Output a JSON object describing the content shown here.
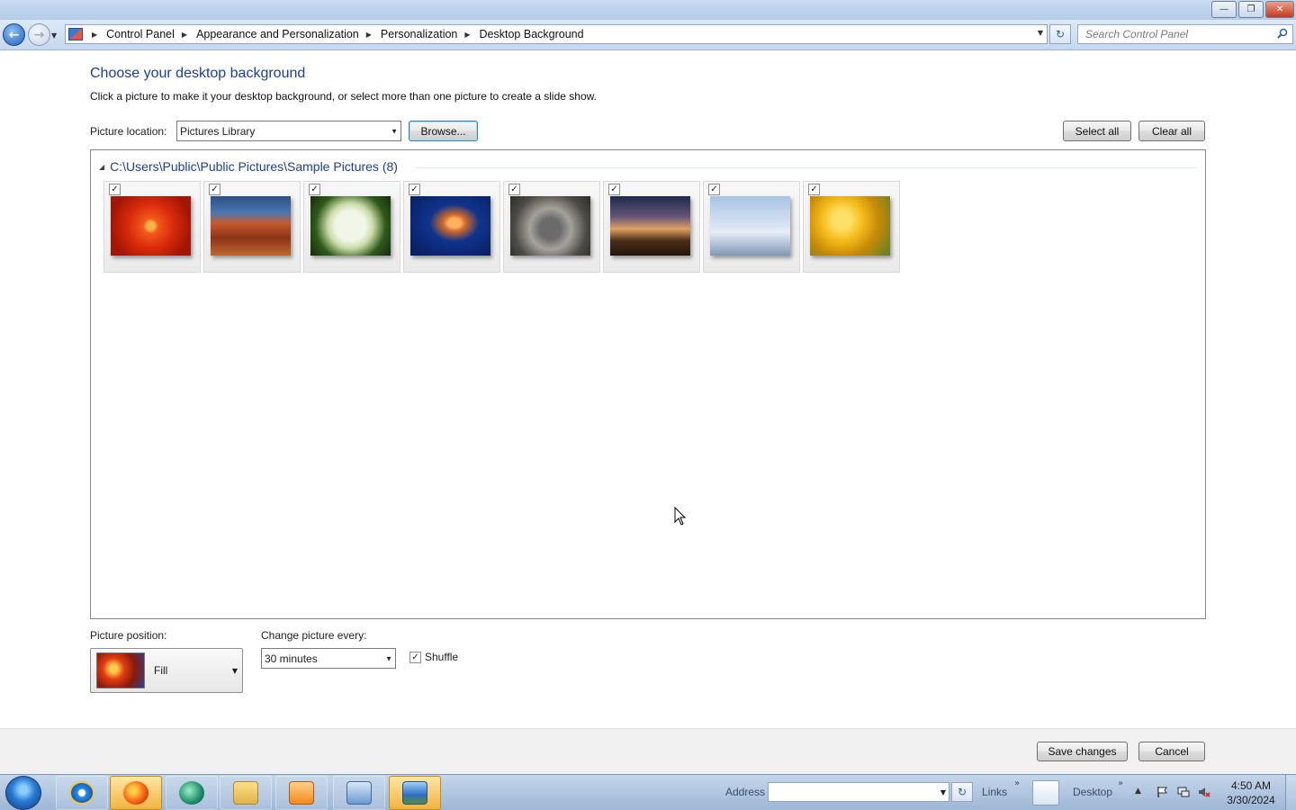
{
  "window": {
    "buttons": [
      "minimize",
      "restore",
      "close"
    ]
  },
  "nav": {
    "breadcrumbs": [
      "Control Panel",
      "Appearance and Personalization",
      "Personalization",
      "Desktop Background"
    ],
    "search_placeholder": "Search Control Panel"
  },
  "content": {
    "heading": "Choose your desktop background",
    "subtext": "Click a picture to make it your desktop background, or select more than one picture to create a slide show.",
    "location_label": "Picture location:",
    "location_value": "Pictures Library",
    "browse_label": "Browse...",
    "select_all_label": "Select all",
    "clear_all_label": "Clear all",
    "group_title": "C:\\Users\\Public\\Public Pictures\\Sample Pictures (8)",
    "pictures": [
      {
        "name": "chrysanthemum",
        "checked": true
      },
      {
        "name": "desert",
        "checked": true
      },
      {
        "name": "hydrangeas",
        "checked": true
      },
      {
        "name": "jellyfish",
        "checked": true
      },
      {
        "name": "koala",
        "checked": true
      },
      {
        "name": "lighthouse",
        "checked": true
      },
      {
        "name": "penguins",
        "checked": true
      },
      {
        "name": "tulips",
        "checked": true
      }
    ],
    "position_label": "Picture position:",
    "position_value": "Fill",
    "change_label": "Change picture every:",
    "change_value": "30 minutes",
    "shuffle_label": "Shuffle",
    "shuffle_checked": true
  },
  "footer": {
    "save_label": "Save changes",
    "cancel_label": "Cancel"
  },
  "taskbar": {
    "address_label": "Address",
    "links_label": "Links",
    "desktop_label": "Desktop",
    "time": "4:50 AM",
    "date": "3/30/2024",
    "apps": [
      "internet-explorer",
      "firefox",
      "chat-app",
      "windows-explorer",
      "media-player",
      "control-panel",
      "personalization"
    ]
  },
  "colors": {
    "heading": "#1e3f8e",
    "titlebar": "#c8daf0",
    "taskbar": "#9eb7d6"
  }
}
